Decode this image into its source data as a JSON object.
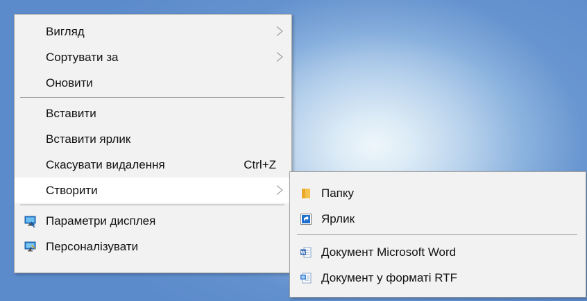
{
  "context_menu": {
    "items": [
      {
        "label": "Вигляд",
        "has_submenu": true
      },
      {
        "label": "Сортувати за",
        "has_submenu": true
      },
      {
        "label": "Оновити"
      },
      {
        "label": "Вставити"
      },
      {
        "label": "Вставити ярлик"
      },
      {
        "label": "Скасувати видалення",
        "shortcut": "Ctrl+Z"
      },
      {
        "label": "Створити",
        "has_submenu": true,
        "highlighted": true
      },
      {
        "label": "Параметри дисплея",
        "icon": "display-settings-icon"
      },
      {
        "label": "Персоналізувати",
        "icon": "personalize-icon"
      }
    ]
  },
  "create_submenu": {
    "items": [
      {
        "label": "Папку",
        "icon": "folder-icon"
      },
      {
        "label": "Ярлик",
        "icon": "shortcut-icon"
      },
      {
        "label": "Документ Microsoft Word",
        "icon": "word-document-icon"
      },
      {
        "label": "Документ у форматі RTF",
        "icon": "rtf-document-icon"
      }
    ]
  },
  "colors": {
    "menu_background": "#f2f2f2",
    "menu_border": "#a0a0a0",
    "highlight_background": "#ffffff",
    "desktop_accent": "#6d9ad2"
  }
}
